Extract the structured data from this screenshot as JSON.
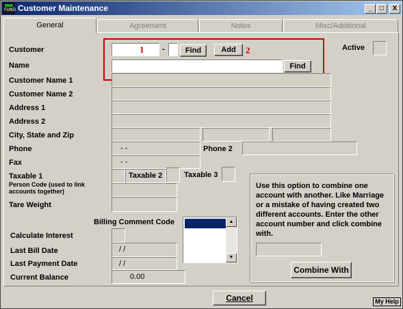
{
  "window": {
    "title": "Customer Maintenance",
    "icon_label": "FUND",
    "minimize_glyph": "_",
    "maximize_glyph": "□",
    "close_glyph": "X"
  },
  "tabs": [
    {
      "label": "General",
      "active": true
    },
    {
      "label": "Agreement",
      "active": false
    },
    {
      "label": "Notes",
      "active": false
    },
    {
      "label": "Misc/Additional",
      "active": false
    }
  ],
  "form": {
    "customer_label": "Customer",
    "customer_dash": "-",
    "customer_find": "Find",
    "customer_add": "Add",
    "marker_1": "1",
    "marker_2": "2",
    "active_label": "Active",
    "name_label": "Name",
    "name_find": "Find",
    "customer_name1_label": "Customer Name 1",
    "customer_name2_label": "Customer Name 2",
    "address1_label": "Address 1",
    "address2_label": "Address 2",
    "city_label": "City, State and Zip",
    "phone_label": "Phone",
    "phone_value": "-  -",
    "phone2_label": "Phone 2",
    "fax_label": "Fax",
    "fax_value": "-  -",
    "taxable1_label": "Taxable 1",
    "taxable2_label": "Taxable 2",
    "taxable3_label": "Taxable 3",
    "person_code_label": "Person Code (used to link accounts together)",
    "tare_weight_label": "Tare Weight",
    "billing_comment_label": "Billing Comment Code",
    "calculate_interest_label": "Calculate Interest",
    "last_bill_date_label": "Last Bill Date",
    "last_bill_date_value": "/ /",
    "last_payment_date_label": "Last Payment Date",
    "last_payment_date_value": "/ /",
    "current_balance_label": "Current Balance",
    "current_balance_value": "0.00"
  },
  "combine": {
    "text": "Use this option to combine one account with another.  Like Marriage or a mistake of having created two different accounts.  Enter the other account number and click combine with.",
    "button": "Combine With"
  },
  "footer": {
    "cancel": "Cancel",
    "my_help": "My Help"
  },
  "colors": {
    "title_start": "#0a246a",
    "title_end": "#a6caf0",
    "annotation_red": "#c00000",
    "face": "#d4d0c8"
  }
}
